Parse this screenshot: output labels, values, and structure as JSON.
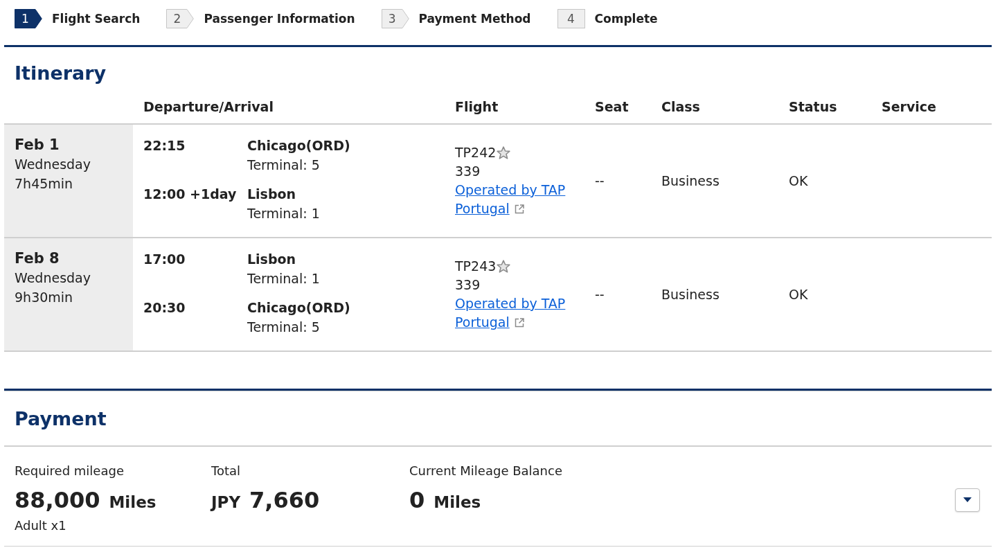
{
  "steps": [
    {
      "number": "1",
      "label": "Flight Search",
      "selected": true
    },
    {
      "number": "2",
      "label": "Passenger Information",
      "selected": false
    },
    {
      "number": "3",
      "label": "Payment Method",
      "selected": false
    },
    {
      "number": "4",
      "label": "Complete",
      "selected": false
    }
  ],
  "itinerary": {
    "title": "Itinerary",
    "columns": [
      "Departure/Arrival",
      "Flight",
      "Seat",
      "Class",
      "Status",
      "Service"
    ],
    "rows": [
      {
        "date": "Feb 1",
        "weekday": "Wednesday",
        "duration": "7h45min",
        "segments": [
          {
            "time": "22:15",
            "city": "Chicago(ORD)",
            "terminal": "Terminal: 5"
          },
          {
            "time": "12:00 +1day",
            "city": "Lisbon",
            "terminal": "Terminal: 1"
          }
        ],
        "flight": {
          "number": "TP242",
          "aircraft": "339",
          "operator_link": "Operated by TAP Portugal"
        },
        "seat": "--",
        "class": "Business",
        "status": "OK"
      },
      {
        "date": "Feb 8",
        "weekday": "Wednesday",
        "duration": "9h30min",
        "segments": [
          {
            "time": "17:00",
            "city": "Lisbon",
            "terminal": "Terminal: 1"
          },
          {
            "time": "20:30",
            "city": "Chicago(ORD)",
            "terminal": "Terminal: 5"
          }
        ],
        "flight": {
          "number": "TP243",
          "aircraft": "339",
          "operator_link": "Operated by TAP Portugal"
        },
        "seat": "--",
        "class": "Business",
        "status": "OK"
      }
    ]
  },
  "payment": {
    "title": "Payment",
    "items": [
      {
        "label": "Required mileage",
        "amount": "88,000",
        "unit": "Miles",
        "note": "Adult x1"
      },
      {
        "label": "Total",
        "currency": "JPY",
        "amount": "7,660"
      },
      {
        "label": "Current Mileage Balance",
        "amount": "0",
        "unit": "Miles"
      }
    ]
  }
}
